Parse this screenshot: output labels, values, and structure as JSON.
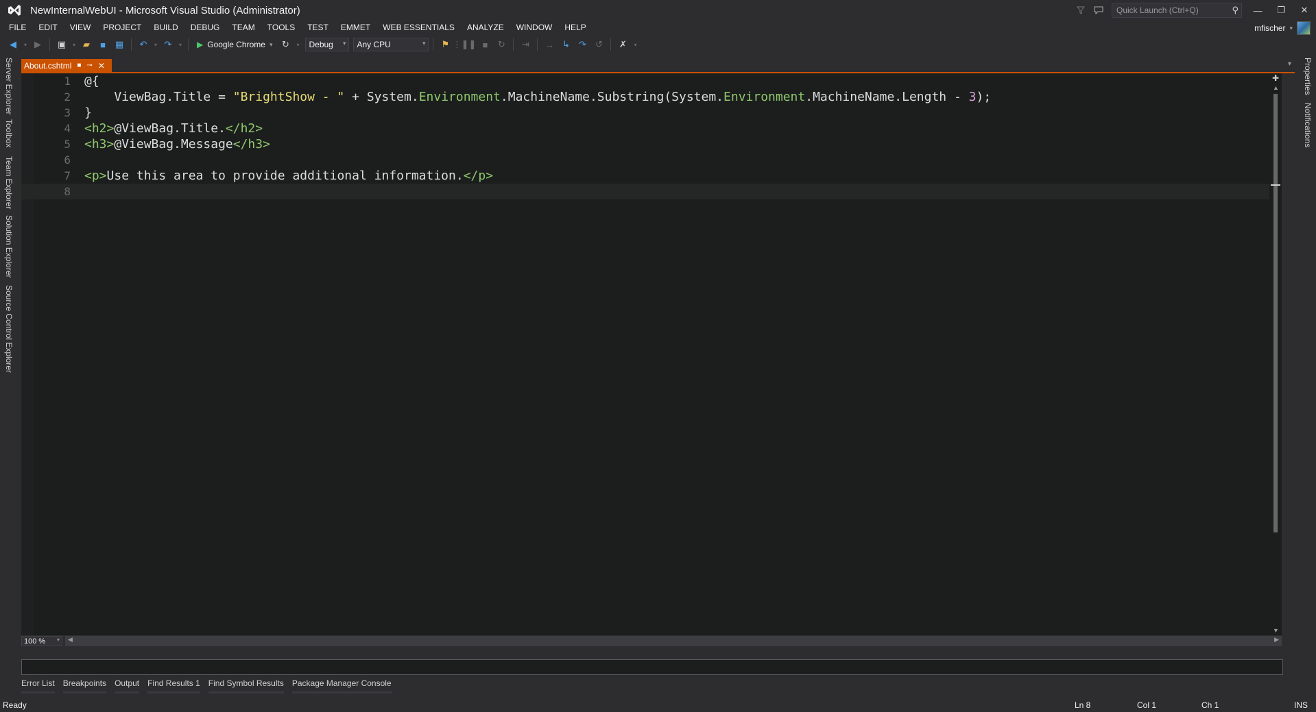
{
  "window": {
    "title": "NewInternalWebUI - Microsoft Visual Studio (Administrator)",
    "quick_launch_placeholder": "Quick Launch (Ctrl+Q)"
  },
  "menu": [
    "FILE",
    "EDIT",
    "VIEW",
    "PROJECT",
    "BUILD",
    "DEBUG",
    "TEAM",
    "TOOLS",
    "TEST",
    "EMMET",
    "WEB ESSENTIALS",
    "ANALYZE",
    "WINDOW",
    "HELP"
  ],
  "user": {
    "name": "mfischer"
  },
  "toolbar": {
    "run_target": "Google Chrome",
    "configuration": "Debug",
    "platform": "Any CPU"
  },
  "left_tools": [
    "Server Explorer",
    "Toolbox",
    "Team Explorer",
    "Solution Explorer",
    "Source Control Explorer"
  ],
  "right_tools": [
    "Properties",
    "Notifications"
  ],
  "document_tab": {
    "name": "About.cshtml"
  },
  "editor": {
    "line_numbers": [
      "1",
      "2",
      "3",
      "4",
      "5",
      "6",
      "7",
      "8"
    ],
    "zoom": "100 %"
  },
  "bottom_tabs": [
    "Error List",
    "Breakpoints",
    "Output",
    "Find Results 1",
    "Find Symbol Results",
    "Package Manager Console"
  ],
  "status": {
    "ready": "Ready",
    "ln": "Ln 8",
    "col": "Col 1",
    "ch": "Ch 1",
    "ins": "INS"
  }
}
